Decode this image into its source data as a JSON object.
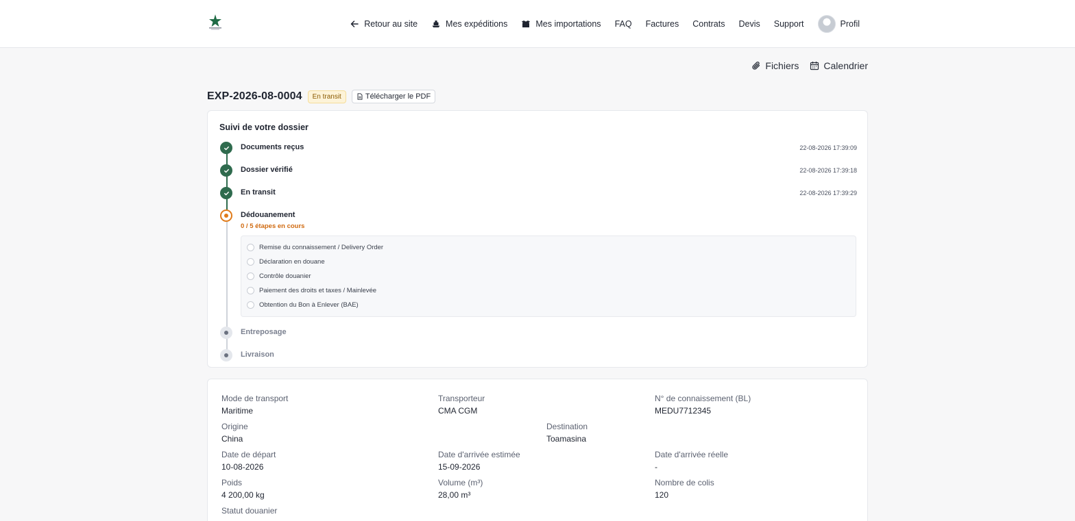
{
  "nav": {
    "back": "Retour au site",
    "shipments": "Mes expéditions",
    "imports": "Mes importations",
    "faq": "FAQ",
    "invoices": "Factures",
    "contracts": "Contrats",
    "quotes": "Devis",
    "support": "Support",
    "profile": "Profil"
  },
  "actions": {
    "files": "Fichiers",
    "calendar": "Calendrier"
  },
  "shipment": {
    "reference": "EXP-2026-08-0004",
    "status_badge": "En transit",
    "pdf_button": "Télécharger le PDF"
  },
  "tracking": {
    "title": "Suivi de votre dossier",
    "steps": [
      {
        "label": "Documents reçus",
        "time": "22-08-2026 17:39:09",
        "state": "done"
      },
      {
        "label": "Dossier vérifié",
        "time": "22-08-2026 17:39:18",
        "state": "done"
      },
      {
        "label": "En transit",
        "time": "22-08-2026 17:39:29",
        "state": "done"
      },
      {
        "label": "Dédouanement",
        "progress": "0 / 5 étapes en cours",
        "state": "current"
      },
      {
        "label": "Entreposage",
        "state": "pending"
      },
      {
        "label": "Livraison",
        "state": "pending"
      }
    ],
    "customs_substeps": [
      "Remise du connaissement / Delivery Order",
      "Déclaration en douane",
      "Contrôle douanier",
      "Paiement des droits et taxes / Mainlevée",
      "Obtention du Bon à Enlever (BAE)"
    ]
  },
  "details": {
    "transport_mode": {
      "label": "Mode de transport",
      "value": "Maritime"
    },
    "carrier": {
      "label": "Transporteur",
      "value": "CMA CGM"
    },
    "bl_number": {
      "label": "N° de connaissement (BL)",
      "value": "MEDU7712345"
    },
    "origin": {
      "label": "Origine",
      "value": "China"
    },
    "destination": {
      "label": "Destination",
      "value": "Toamasina"
    },
    "departure_date": {
      "label": "Date de départ",
      "value": "10-08-2026"
    },
    "eta": {
      "label": "Date d'arrivée estimée",
      "value": "15-09-2026"
    },
    "actual_arrival": {
      "label": "Date d'arrivée réelle",
      "value": "-"
    },
    "weight": {
      "label": "Poids",
      "value": "4 200,00 kg"
    },
    "volume": {
      "label": "Volume (m³)",
      "value": "28,00 m³"
    },
    "packages": {
      "label": "Nombre de colis",
      "value": "120"
    },
    "customs_status": {
      "label": "Statut douanier"
    }
  },
  "colors": {
    "done": "#2f6b4e",
    "current": "#e07b1a",
    "badge_bg": "#fdf3d8"
  }
}
